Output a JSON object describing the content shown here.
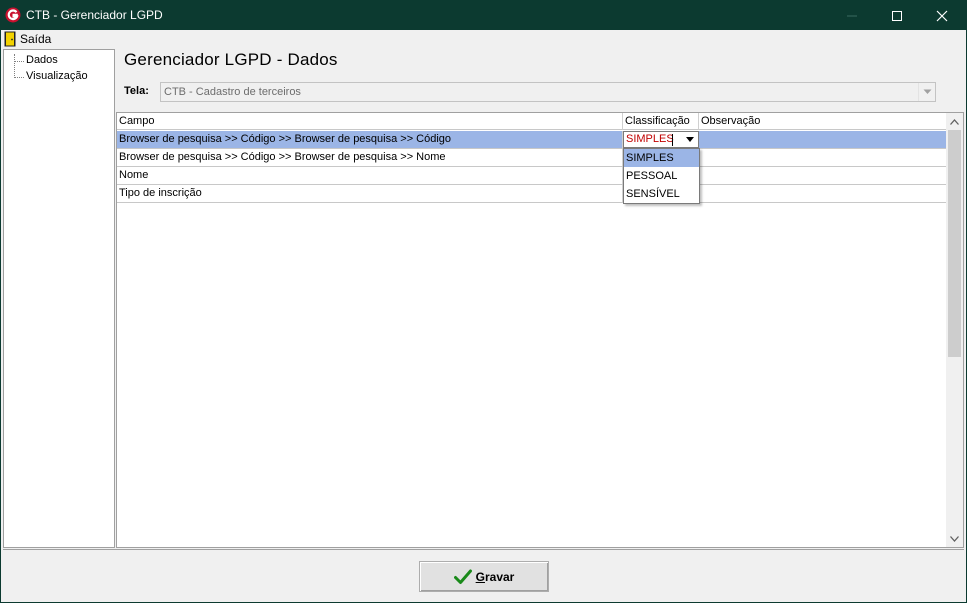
{
  "window": {
    "title": "CTB - Gerenciador LGPD"
  },
  "menu": {
    "exit_label": "Saída"
  },
  "tree": {
    "items": [
      {
        "label": "Dados"
      },
      {
        "label": "Visualização"
      }
    ]
  },
  "main": {
    "title": "Gerenciador LGPD - Dados",
    "tela_label": "Tela:",
    "tela_value": "CTB - Cadastro de terceiros"
  },
  "grid": {
    "columns": [
      "Campo",
      "Classificação",
      "Observação"
    ],
    "rows": [
      {
        "campo": "Browser de pesquisa >> Código >> Browser de pesquisa >> Código",
        "classificacao": "SIMPLES",
        "observacao": ""
      },
      {
        "campo": "Browser de pesquisa >> Código >> Browser de pesquisa >> Nome",
        "classificacao": "",
        "observacao": ""
      },
      {
        "campo": "Nome",
        "classificacao": "",
        "observacao": ""
      },
      {
        "campo": "Tipo de inscrição",
        "classificacao": "",
        "observacao": ""
      }
    ],
    "editor": {
      "value": "SIMPLES",
      "options": [
        "SIMPLES",
        "PESSOAL",
        "SENSÍVEL"
      ],
      "highlighted": "SIMPLES"
    }
  },
  "footer": {
    "save_label_first": "G",
    "save_label_rest": "ravar"
  },
  "colors": {
    "titlebar": "#0c3a30",
    "selection": "#9bb5e6",
    "editor_text": "#c00000",
    "check": "#1a8a1a"
  }
}
